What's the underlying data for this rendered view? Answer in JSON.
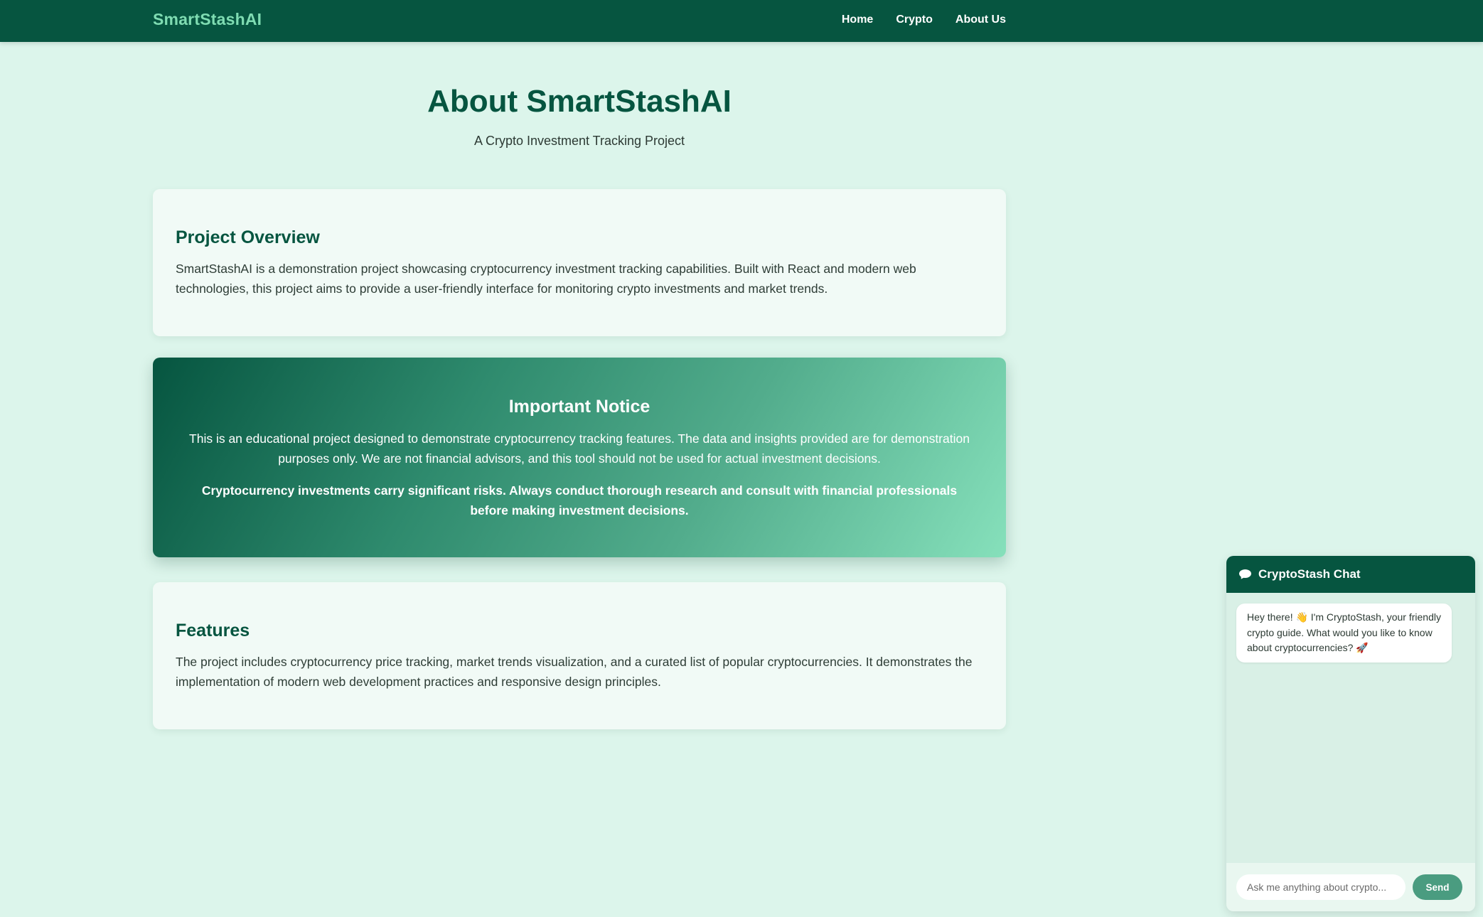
{
  "navbar": {
    "brand": "SmartStashAI",
    "links": [
      "Home",
      "Crypto",
      "About Us"
    ]
  },
  "hero": {
    "title": "About SmartStashAI",
    "subtitle": "A Crypto Investment Tracking Project"
  },
  "overview": {
    "heading": "Project Overview",
    "body": "SmartStashAI is a demonstration project showcasing cryptocurrency investment tracking capabilities. Built with React and modern web technologies, this project aims to provide a user-friendly interface for monitoring crypto investments and market trends."
  },
  "notice": {
    "heading": "Important Notice",
    "body": "This is an educational project designed to demonstrate cryptocurrency tracking features. The data and insights provided are for demonstration purposes only. We are not financial advisors, and this tool should not be used for actual investment decisions.",
    "warning": "Cryptocurrency investments carry significant risks. Always conduct thorough research and consult with financial professionals before making investment decisions."
  },
  "features": {
    "heading": "Features",
    "body": "The project includes cryptocurrency price tracking, market trends visualization, and a curated list of popular cryptocurrencies. It demonstrates the implementation of modern web development practices and responsive design principles."
  },
  "chat": {
    "title": "CryptoStash Chat",
    "header_icon": "speech-bubble-icon",
    "messages": [
      {
        "from": "bot",
        "text": "Hey there! 👋 I'm CryptoStash, your friendly crypto guide. What would you like to know about cryptocurrencies? 🚀"
      }
    ],
    "input_placeholder": "Ask me anything about crypto...",
    "input_value": "",
    "send_label": "Send"
  },
  "colors": {
    "nav_bg": "#065540",
    "brand": "#7fdcb2",
    "page_bg": "#dcf5eb",
    "heading": "#065540",
    "send_button": "#4a9c80"
  }
}
